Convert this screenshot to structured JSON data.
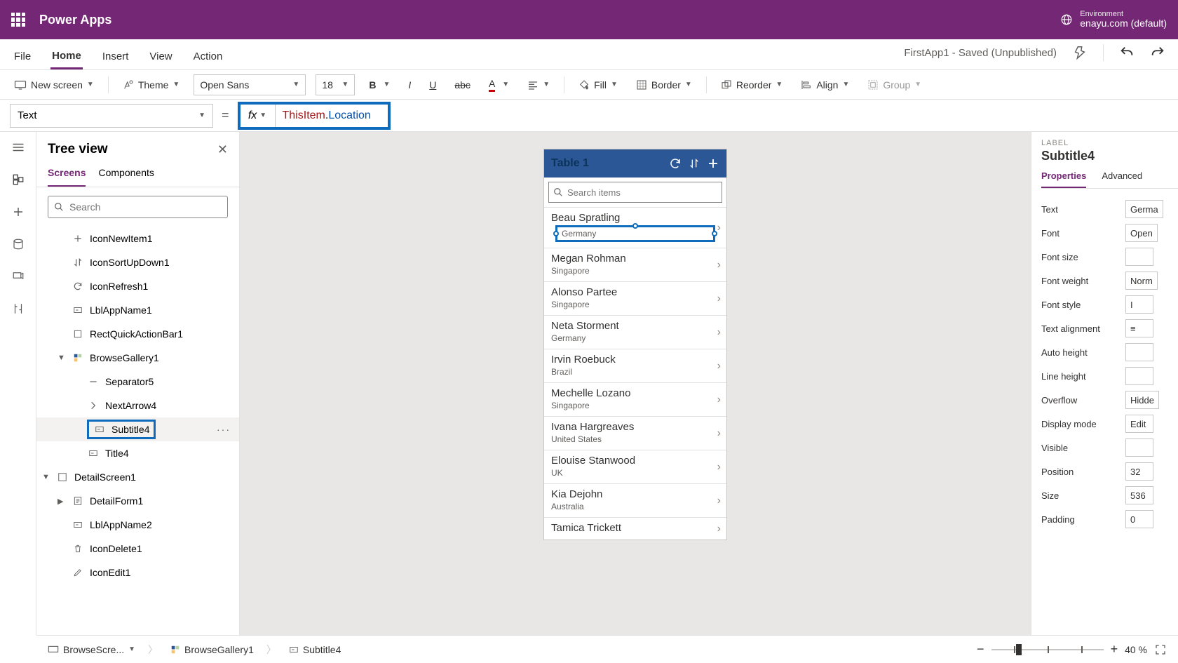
{
  "header": {
    "app_title": "Power Apps",
    "env_label": "Environment",
    "env_name": "enayu.com (default)"
  },
  "menubar": {
    "items": [
      "File",
      "Home",
      "Insert",
      "View",
      "Action"
    ],
    "active": "Home",
    "status": "FirstApp1 - Saved (Unpublished)"
  },
  "toolbar": {
    "new_screen": "New screen",
    "theme": "Theme",
    "font_name": "Open Sans",
    "font_size": "18",
    "fill": "Fill",
    "border": "Border",
    "reorder": "Reorder",
    "align": "Align",
    "group": "Group"
  },
  "formula": {
    "property": "Text",
    "fx_label": "fx",
    "expression_obj": "ThisItem",
    "expression_prop": "Location"
  },
  "tree": {
    "title": "Tree view",
    "tabs": {
      "screens": "Screens",
      "components": "Components"
    },
    "search_placeholder": "Search",
    "items": [
      {
        "label": "IconNewItem1",
        "indent": 2,
        "icon": "plus"
      },
      {
        "label": "IconSortUpDown1",
        "indent": 2,
        "icon": "sort"
      },
      {
        "label": "IconRefresh1",
        "indent": 2,
        "icon": "refresh"
      },
      {
        "label": "LblAppName1",
        "indent": 2,
        "icon": "label"
      },
      {
        "label": "RectQuickActionBar1",
        "indent": 2,
        "icon": "rect"
      },
      {
        "label": "BrowseGallery1",
        "indent": 2,
        "icon": "gallery",
        "expand": true
      },
      {
        "label": "Separator5",
        "indent": 3,
        "icon": "sep"
      },
      {
        "label": "NextArrow4",
        "indent": 3,
        "icon": "arrow"
      },
      {
        "label": "Subtitle4",
        "indent": 3,
        "icon": "label",
        "selected": true
      },
      {
        "label": "Title4",
        "indent": 3,
        "icon": "label"
      },
      {
        "label": "DetailScreen1",
        "indent": 1,
        "icon": "screen",
        "expand": true
      },
      {
        "label": "DetailForm1",
        "indent": 2,
        "icon": "form",
        "collapsed": true
      },
      {
        "label": "LblAppName2",
        "indent": 2,
        "icon": "label"
      },
      {
        "label": "IconDelete1",
        "indent": 2,
        "icon": "delete"
      },
      {
        "label": "IconEdit1",
        "indent": 2,
        "icon": "edit"
      }
    ]
  },
  "canvas": {
    "screen_title": "Table 1",
    "search_placeholder": "Search items",
    "selected_subtitle": "Germany",
    "rows": [
      {
        "name": "Beau Spratling",
        "loc": "Germany",
        "first": true
      },
      {
        "name": "Megan Rohman",
        "loc": "Singapore"
      },
      {
        "name": "Alonso Partee",
        "loc": "Singapore"
      },
      {
        "name": "Neta Storment",
        "loc": "Germany"
      },
      {
        "name": "Irvin Roebuck",
        "loc": "Brazil"
      },
      {
        "name": "Mechelle Lozano",
        "loc": "Singapore"
      },
      {
        "name": "Ivana Hargreaves",
        "loc": "United States"
      },
      {
        "name": "Elouise Stanwood",
        "loc": "UK"
      },
      {
        "name": "Kia Dejohn",
        "loc": "Australia"
      },
      {
        "name": "Tamica Trickett",
        "loc": ""
      }
    ]
  },
  "props": {
    "type_label": "LABEL",
    "name": "Subtitle4",
    "tabs": {
      "properties": "Properties",
      "advanced": "Advanced"
    },
    "lines": [
      {
        "k": "Text",
        "v": "Germa"
      },
      {
        "k": "Font",
        "v": "Open"
      },
      {
        "k": "Font size",
        "v": ""
      },
      {
        "k": "Font weight",
        "v": "Norm"
      },
      {
        "k": "Font style",
        "v": "I"
      },
      {
        "k": "Text alignment",
        "v": "≡"
      },
      {
        "k": "Auto height",
        "v": ""
      },
      {
        "k": "Line height",
        "v": ""
      },
      {
        "k": "Overflow",
        "v": "Hidde"
      },
      {
        "k": "Display mode",
        "v": "Edit"
      },
      {
        "k": "Visible",
        "v": ""
      },
      {
        "k": "Position",
        "v": "32"
      },
      {
        "k": "Size",
        "v": "536"
      },
      {
        "k": "Padding",
        "v": "0"
      }
    ]
  },
  "footer": {
    "crumbs": [
      "BrowseScre...",
      "BrowseGallery1",
      "Subtitle4"
    ],
    "zoom_pct": "40 %"
  }
}
